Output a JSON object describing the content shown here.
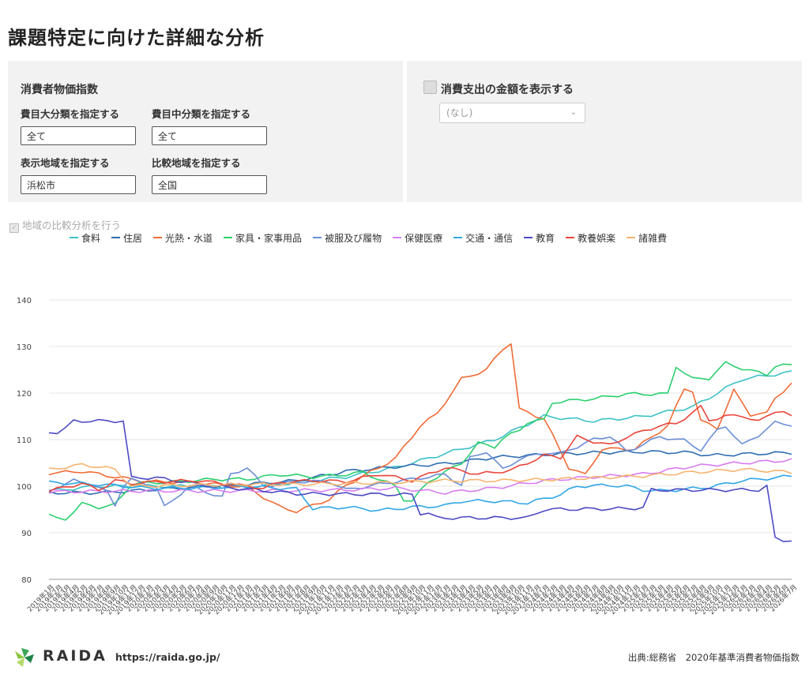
{
  "page": {
    "title": "課題特定に向けた詳細な分析"
  },
  "filters": {
    "section_title": "消費者物価指数",
    "major_label": "費目大分類を指定する",
    "major_value": "全て",
    "middle_label": "費目中分類を指定する",
    "middle_value": "全て",
    "region_label": "表示地域を指定する",
    "region_value": "浜松市",
    "compare_label": "比較地域を指定する",
    "compare_value": "全国"
  },
  "spending": {
    "checkbox_label": "消費支出の金額を表示する",
    "select_value": "(なし)"
  },
  "compare_toggle": {
    "label": "地域の比較分析を行う"
  },
  "footer": {
    "brand": "RAIDA",
    "url": "https://raida.go.jp/",
    "source": "出典:総務省　2020年基準消費者物価指数"
  },
  "chart_data": {
    "type": "line",
    "ylim": [
      80,
      140
    ],
    "yticks": [
      80,
      90,
      100,
      110,
      120,
      130,
      140
    ],
    "x_start": "2019年1月",
    "x_end": "2025年7月",
    "grid": "horizontal",
    "legend_position": "top",
    "series": [
      {
        "name": "食料",
        "color": "#3cc1c6",
        "anchors": [
          [
            0,
            99
          ],
          [
            6,
            100
          ],
          [
            12,
            100
          ],
          [
            18,
            100
          ],
          [
            24,
            99.8
          ],
          [
            30,
            100.8
          ],
          [
            36,
            102
          ],
          [
            42,
            104
          ],
          [
            48,
            107
          ],
          [
            54,
            110
          ],
          [
            60,
            115
          ],
          [
            66,
            114
          ],
          [
            72,
            115
          ],
          [
            78,
            117
          ],
          [
            84,
            123
          ],
          [
            88,
            124
          ],
          [
            90,
            124.5
          ]
        ]
      },
      {
        "name": "住居",
        "color": "#2e6db0",
        "anchors": [
          [
            0,
            98.6
          ],
          [
            6,
            98.6
          ],
          [
            12,
            99.2
          ],
          [
            18,
            99.8
          ],
          [
            24,
            100.4
          ],
          [
            30,
            101.2
          ],
          [
            36,
            103.2
          ],
          [
            42,
            104.2
          ],
          [
            48,
            104.8
          ],
          [
            54,
            106.2
          ],
          [
            60,
            106.8
          ],
          [
            66,
            107.2
          ],
          [
            72,
            107.4
          ],
          [
            78,
            107.2
          ],
          [
            80,
            106.6
          ],
          [
            86,
            107
          ],
          [
            90,
            107.2
          ]
        ]
      },
      {
        "name": "光熱・水道",
        "color": "#f06b36",
        "anchors": [
          [
            0,
            102.8
          ],
          [
            4,
            103.2
          ],
          [
            8,
            102
          ],
          [
            12,
            101
          ],
          [
            18,
            100.8
          ],
          [
            24,
            99.8
          ],
          [
            28,
            95.5
          ],
          [
            30,
            94.6
          ],
          [
            34,
            97.2
          ],
          [
            36,
            100.2
          ],
          [
            40,
            104
          ],
          [
            42,
            106
          ],
          [
            45,
            113
          ],
          [
            47,
            115.5
          ],
          [
            50,
            123
          ],
          [
            53,
            125
          ],
          [
            55,
            129.5
          ],
          [
            56,
            130.8
          ],
          [
            57,
            116.5
          ],
          [
            60,
            114.5
          ],
          [
            63,
            104
          ],
          [
            65,
            102.4
          ],
          [
            67,
            108
          ],
          [
            71,
            108
          ],
          [
            75,
            113
          ],
          [
            77,
            121
          ],
          [
            78,
            120.5
          ],
          [
            79,
            114
          ],
          [
            81,
            112.5
          ],
          [
            83,
            120.5
          ],
          [
            85,
            115.4
          ],
          [
            87,
            115.6
          ],
          [
            88,
            119
          ],
          [
            90,
            122
          ]
        ]
      },
      {
        "name": "家具・家事用品",
        "color": "#2bcf6f",
        "anchors": [
          [
            0,
            93.8
          ],
          [
            1,
            93
          ],
          [
            2,
            93
          ],
          [
            4,
            96.2
          ],
          [
            6,
            95.5
          ],
          [
            8,
            96
          ],
          [
            10,
            100.5
          ],
          [
            16,
            101
          ],
          [
            20,
            101.5
          ],
          [
            24,
            101.5
          ],
          [
            28,
            102.5
          ],
          [
            32,
            102
          ],
          [
            36,
            102.5
          ],
          [
            38,
            103
          ],
          [
            42,
            100
          ],
          [
            43,
            97.2
          ],
          [
            44,
            96.8
          ],
          [
            46,
            101
          ],
          [
            50,
            105
          ],
          [
            52,
            109.2
          ],
          [
            54,
            108.5
          ],
          [
            55,
            110.2
          ],
          [
            57,
            112
          ],
          [
            58,
            113.8
          ],
          [
            60,
            114.2
          ],
          [
            61,
            118
          ],
          [
            66,
            118.8
          ],
          [
            70,
            119.8
          ],
          [
            75,
            119.8
          ],
          [
            76,
            125.8
          ],
          [
            78,
            123
          ],
          [
            80,
            123.2
          ],
          [
            82,
            126.4
          ],
          [
            85,
            124.8
          ],
          [
            87,
            124
          ],
          [
            88,
            125.8
          ],
          [
            90,
            126
          ]
        ]
      },
      {
        "name": "被服及び履物",
        "color": "#6b8ed6",
        "anchors": [
          [
            0,
            99
          ],
          [
            3,
            101.2
          ],
          [
            5,
            100.5
          ],
          [
            7,
            98.8
          ],
          [
            8,
            96
          ],
          [
            9,
            100
          ],
          [
            10,
            101.4
          ],
          [
            13,
            99.8
          ],
          [
            14,
            95.5
          ],
          [
            17,
            100
          ],
          [
            19,
            98.8
          ],
          [
            21,
            97.6
          ],
          [
            22,
            102.5
          ],
          [
            24,
            104
          ],
          [
            26,
            100
          ],
          [
            30,
            101
          ],
          [
            34,
            101
          ],
          [
            36,
            99.2
          ],
          [
            42,
            101
          ],
          [
            48,
            102.5
          ],
          [
            50,
            100.2
          ],
          [
            51,
            106
          ],
          [
            53,
            107.5
          ],
          [
            55,
            103.6
          ],
          [
            57,
            105.8
          ],
          [
            60,
            107.2
          ],
          [
            62,
            107
          ],
          [
            66,
            110
          ],
          [
            68,
            110.8
          ],
          [
            70,
            107.4
          ],
          [
            74,
            110.6
          ],
          [
            77,
            109.8
          ],
          [
            79,
            107.8
          ],
          [
            81,
            112
          ],
          [
            82,
            113
          ],
          [
            84,
            108.8
          ],
          [
            86,
            111
          ],
          [
            88,
            113.6
          ],
          [
            90,
            113.2
          ]
        ]
      },
      {
        "name": "保健医療",
        "color": "#d87df0",
        "anchors": [
          [
            0,
            98.8
          ],
          [
            12,
            99
          ],
          [
            24,
            99
          ],
          [
            36,
            99.2
          ],
          [
            42,
            99.6
          ],
          [
            48,
            98.6
          ],
          [
            54,
            99.6
          ],
          [
            60,
            101.2
          ],
          [
            66,
            102
          ],
          [
            72,
            102.6
          ],
          [
            78,
            104.3
          ],
          [
            84,
            105
          ],
          [
            90,
            105.6
          ]
        ]
      },
      {
        "name": "交通・通信",
        "color": "#32a8e6",
        "anchors": [
          [
            0,
            100.8
          ],
          [
            6,
            100.4
          ],
          [
            12,
            99.6
          ],
          [
            18,
            99.6
          ],
          [
            24,
            100
          ],
          [
            30,
            99.4
          ],
          [
            32,
            95.2
          ],
          [
            36,
            95.5
          ],
          [
            40,
            94.8
          ],
          [
            44,
            95.5
          ],
          [
            48,
            95.8
          ],
          [
            50,
            96.8
          ],
          [
            54,
            96.8
          ],
          [
            58,
            96.4
          ],
          [
            62,
            98.2
          ],
          [
            64,
            100
          ],
          [
            68,
            100.2
          ],
          [
            70,
            100
          ],
          [
            72,
            99.2
          ],
          [
            74,
            99
          ],
          [
            76,
            99.2
          ],
          [
            80,
            99.8
          ],
          [
            84,
            101.2
          ],
          [
            88,
            101.8
          ],
          [
            90,
            102.2
          ]
        ]
      },
      {
        "name": "教育",
        "color": "#4b4ac4",
        "anchors": [
          [
            0,
            111.6
          ],
          [
            1,
            111.6
          ],
          [
            2,
            112.4
          ],
          [
            3,
            114
          ],
          [
            9,
            114
          ],
          [
            10,
            101.8
          ],
          [
            13,
            101.8
          ],
          [
            20,
            100
          ],
          [
            30,
            98.4
          ],
          [
            44,
            98.2
          ],
          [
            45,
            94.2
          ],
          [
            46,
            94.2
          ],
          [
            47,
            93.2
          ],
          [
            56,
            93.2
          ],
          [
            58,
            93.2
          ],
          [
            60,
            95
          ],
          [
            70,
            95.2
          ],
          [
            72,
            95.4
          ],
          [
            73,
            99.2
          ],
          [
            80,
            99.2
          ],
          [
            86,
            99.2
          ],
          [
            87,
            100
          ],
          [
            88,
            88.8
          ],
          [
            89,
            88.4
          ],
          [
            90,
            88.4
          ]
        ]
      },
      {
        "name": "教養娯楽",
        "color": "#e8463b",
        "anchors": [
          [
            0,
            99
          ],
          [
            4,
            100.6
          ],
          [
            6,
            99.2
          ],
          [
            8,
            101.2
          ],
          [
            10,
            100.6
          ],
          [
            14,
            101
          ],
          [
            18,
            101.2
          ],
          [
            22,
            100.4
          ],
          [
            26,
            99.6
          ],
          [
            28,
            100.8
          ],
          [
            32,
            101.2
          ],
          [
            36,
            101
          ],
          [
            40,
            102.6
          ],
          [
            44,
            101.2
          ],
          [
            48,
            104
          ],
          [
            52,
            102.6
          ],
          [
            56,
            103.4
          ],
          [
            60,
            106.6
          ],
          [
            62,
            106.2
          ],
          [
            64,
            110.6
          ],
          [
            66,
            109.6
          ],
          [
            68,
            108.8
          ],
          [
            70,
            110.6
          ],
          [
            74,
            113
          ],
          [
            76,
            113.4
          ],
          [
            79,
            117
          ],
          [
            80,
            114.2
          ],
          [
            82,
            115
          ],
          [
            84,
            115.2
          ],
          [
            86,
            113.8
          ],
          [
            88,
            116.2
          ],
          [
            89,
            116
          ],
          [
            90,
            114.8
          ]
        ]
      },
      {
        "name": "諸雑費",
        "color": "#f5b470",
        "anchors": [
          [
            0,
            103.6
          ],
          [
            4,
            104.6
          ],
          [
            6,
            104.2
          ],
          [
            8,
            103.6
          ],
          [
            10,
            100
          ],
          [
            18,
            100.2
          ],
          [
            24,
            100.4
          ],
          [
            30,
            100.4
          ],
          [
            36,
            100.6
          ],
          [
            42,
            100.8
          ],
          [
            48,
            101.2
          ],
          [
            54,
            101.2
          ],
          [
            60,
            101.4
          ],
          [
            66,
            101.8
          ],
          [
            72,
            102.2
          ],
          [
            78,
            103
          ],
          [
            84,
            103.6
          ],
          [
            90,
            103
          ]
        ]
      }
    ]
  }
}
